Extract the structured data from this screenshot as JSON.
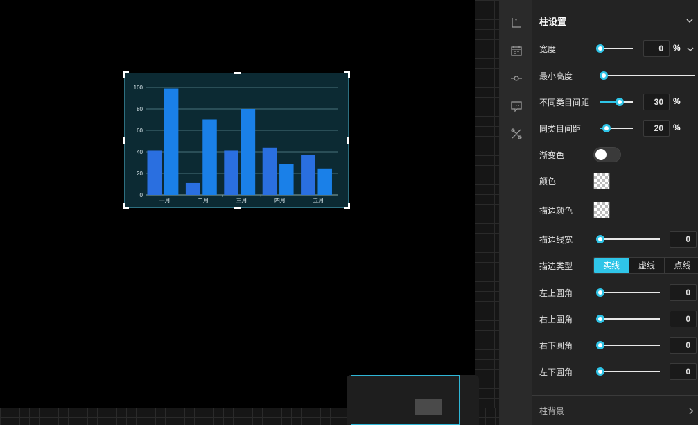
{
  "chart_data": {
    "type": "bar",
    "categories": [
      "一月",
      "二月",
      "三月",
      "四月",
      "五月"
    ],
    "series": [
      {
        "values": [
          41,
          11,
          41,
          44,
          37
        ],
        "color": "#2a6fe0"
      },
      {
        "values": [
          99,
          70,
          80,
          29,
          24
        ],
        "color": "#1a80e8"
      }
    ],
    "yticks": [
      0,
      20,
      40,
      60,
      80,
      100
    ],
    "ylim": [
      0,
      100
    ],
    "grid": true
  },
  "panel": {
    "title": "柱设置",
    "width": {
      "label": "宽度",
      "value": "0",
      "unit": "%",
      "fraction": 0.0
    },
    "min_height": {
      "label": "最小高度",
      "fraction": 0.0
    },
    "category_gap": {
      "label": "不同类目间距",
      "value": "30",
      "unit": "%",
      "fraction": 0.6
    },
    "bar_gap": {
      "label": "同类目间距",
      "value": "20",
      "unit": "%",
      "fraction": 0.2
    },
    "gradient": {
      "label": "渐变色",
      "on": false
    },
    "color": {
      "label": "颜色"
    },
    "border_color": {
      "label": "描边颜色"
    },
    "border_width": {
      "label": "描边线宽",
      "value": "0",
      "fraction": 0.0
    },
    "border_type": {
      "label": "描边类型",
      "options": [
        "实线",
        "虚线",
        "点线"
      ],
      "selected": "实线"
    },
    "radius_tl": {
      "label": "左上圆角",
      "value": "0",
      "fraction": 0.0
    },
    "radius_tr": {
      "label": "右上圆角",
      "value": "0",
      "fraction": 0.0
    },
    "radius_br": {
      "label": "右下圆角",
      "value": "0",
      "fraction": 0.0
    },
    "radius_bl": {
      "label": "左下圆角",
      "value": "0",
      "fraction": 0.0
    },
    "footer": "柱背景"
  },
  "colors": {
    "accent": "#2fc5e8",
    "chart_bg": "#0c2a33"
  },
  "icons": [
    "axis-icon",
    "calendar-icon",
    "series-icon",
    "tooltip-icon",
    "tools-icon"
  ]
}
